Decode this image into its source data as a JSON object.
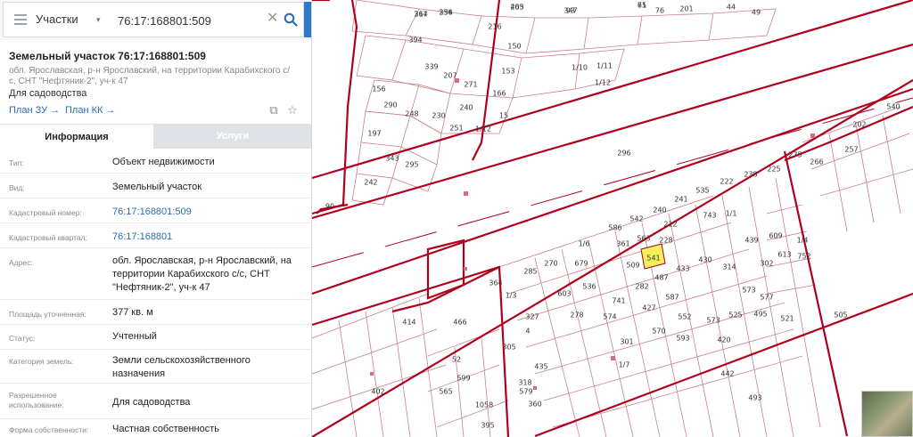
{
  "search": {
    "category": "Участки",
    "query": "76:17:168801:509",
    "menu_icon": "menu-icon",
    "clear_icon": "close-icon",
    "search_icon": "search-icon",
    "toggle_icon": "chevron-left-icon"
  },
  "parcel": {
    "title": "Земельный участок 76:17:168801:509",
    "address_short": "обл. Ярославская, р-н Ярославский, на территории Карабихского с/с, СНТ \"Нефтяник-2\", уч-к 47",
    "usage": "Для садоводства",
    "links": {
      "plan_zu": "План ЗУ →",
      "plan_kk": "План КК →"
    },
    "tools": [
      "layers-icon",
      "star-icon"
    ]
  },
  "tabs": {
    "info": "Информация",
    "services": "Услуги"
  },
  "info_rows": [
    {
      "label": "Тип:",
      "value": "Объект недвижимости",
      "link": false
    },
    {
      "label": "Вид:",
      "value": "Земельный участок",
      "link": false
    },
    {
      "label": "Кадастровый номер:",
      "value": "76:17:168801:509",
      "link": true
    },
    {
      "label": "Кадастровый квартал:",
      "value": "76:17:168801",
      "link": true
    },
    {
      "label": "Адрес:",
      "value": "обл. Ярославская, р-н Ярославский, на территории Карабихского с/с, СНТ \"Нефтяник-2\", уч-к 47",
      "link": false
    },
    {
      "label": "Площадь уточненная:",
      "value": "377 кв. м",
      "link": false
    },
    {
      "label": "Статус:",
      "value": "Учтенный",
      "link": false
    },
    {
      "label": "Категория земель:",
      "value": "Земли сельскохозяйственного назначения",
      "link": false
    },
    {
      "label": "Разрешенное использование:",
      "value": "Для садоводства",
      "link": false
    },
    {
      "label": "Форма собственности:",
      "value": "Частная собственность",
      "link": false
    }
  ],
  "map": {
    "highlighted_plot": "509",
    "highlight_color": "#f5ef5b",
    "boundary_color": "#b0001e",
    "plot_numbers": [
      "214",
      "234",
      "263",
      "93",
      "75",
      "76",
      "201",
      "44",
      "49",
      "394",
      "339",
      "207",
      "271",
      "156",
      "216",
      "150",
      "153",
      "166",
      "15",
      "1/12",
      "1/10",
      "1/11",
      "1/12",
      "290",
      "248",
      "230",
      "240",
      "197",
      "343",
      "295",
      "251",
      "242",
      "296",
      "90",
      "1/6",
      "586",
      "542",
      "240",
      "241",
      "535",
      "222",
      "238",
      "225",
      "275",
      "266",
      "257",
      "202",
      "540",
      "361",
      "563",
      "541",
      "509",
      "228",
      "212",
      "743",
      "1/1",
      "439",
      "302",
      "609",
      "613",
      "752",
      "1/4",
      "364",
      "285",
      "270",
      "679",
      "536",
      "282",
      "487",
      "433",
      "430",
      "314",
      "573",
      "1/3",
      "603",
      "741",
      "574",
      "427",
      "587",
      "552",
      "573",
      "525",
      "577",
      "521",
      "505",
      "495",
      "414",
      "466",
      "52",
      "305",
      "278",
      "301",
      "1/7",
      "570",
      "593",
      "420",
      "442",
      "493",
      "1058",
      "395",
      "360",
      "318",
      "435",
      "4",
      "327",
      "599",
      "579",
      "565",
      "402",
      "367",
      "356",
      "405",
      "347",
      "61"
    ]
  }
}
